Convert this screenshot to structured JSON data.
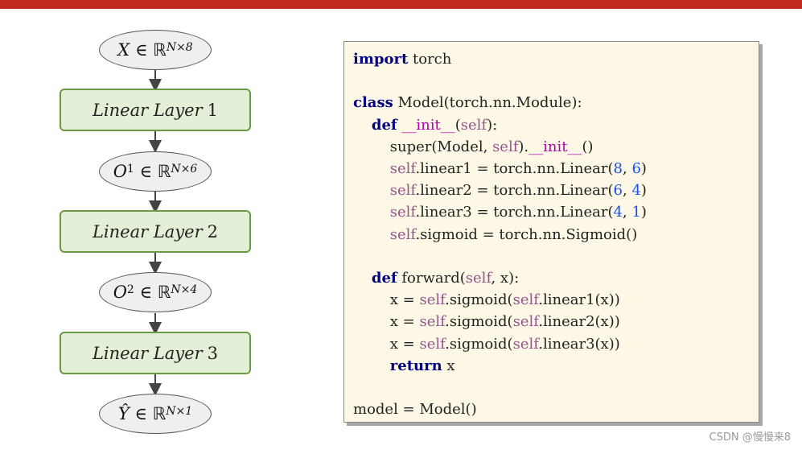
{
  "diagram": {
    "nodes": [
      {
        "kind": "tensor",
        "symbol": "X",
        "sup": "N×8",
        "dims": "ℝ",
        "op": "∈"
      },
      {
        "kind": "layer",
        "label": "Linear Layer",
        "index": "1"
      },
      {
        "kind": "tensor",
        "symbol": "O",
        "index": "1",
        "sup": "N×6",
        "dims": "ℝ",
        "op": "∈"
      },
      {
        "kind": "layer",
        "label": "Linear Layer",
        "index": "2"
      },
      {
        "kind": "tensor",
        "symbol": "O",
        "index": "2",
        "sup": "N×4",
        "dims": "ℝ",
        "op": "∈"
      },
      {
        "kind": "layer",
        "label": "Linear Layer",
        "index": "3"
      },
      {
        "kind": "tensor",
        "symbol": "Ŷ",
        "sup": "N×1",
        "dims": "ℝ",
        "op": "∈"
      }
    ]
  },
  "code": {
    "lines": [
      "import torch",
      "",
      "class Model(torch.nn.Module):",
      "    def __init__(self):",
      "        super(Model, self).__init__()",
      "        self.linear1 = torch.nn.Linear(8, 6)",
      "        self.linear2 = torch.nn.Linear(6, 4)",
      "        self.linear3 = torch.nn.Linear(4, 1)",
      "        self.sigmoid = torch.nn.Sigmoid()",
      "",
      "    def forward(self, x):",
      "        x = self.sigmoid(self.linear1(x))",
      "        x = self.sigmoid(self.linear2(x))",
      "        x = self.sigmoid(self.linear3(x))",
      "        return x",
      "",
      "model = Model()"
    ]
  },
  "watermark": "CSDN @慢慢来8",
  "colors": {
    "top_bar": "#c0291e",
    "layer_fill": "#e3efd6",
    "layer_border": "#6a9a44",
    "code_bg": "#fdf8e5",
    "keyword": "#000080",
    "self": "#94558d",
    "number": "#1750eb"
  }
}
